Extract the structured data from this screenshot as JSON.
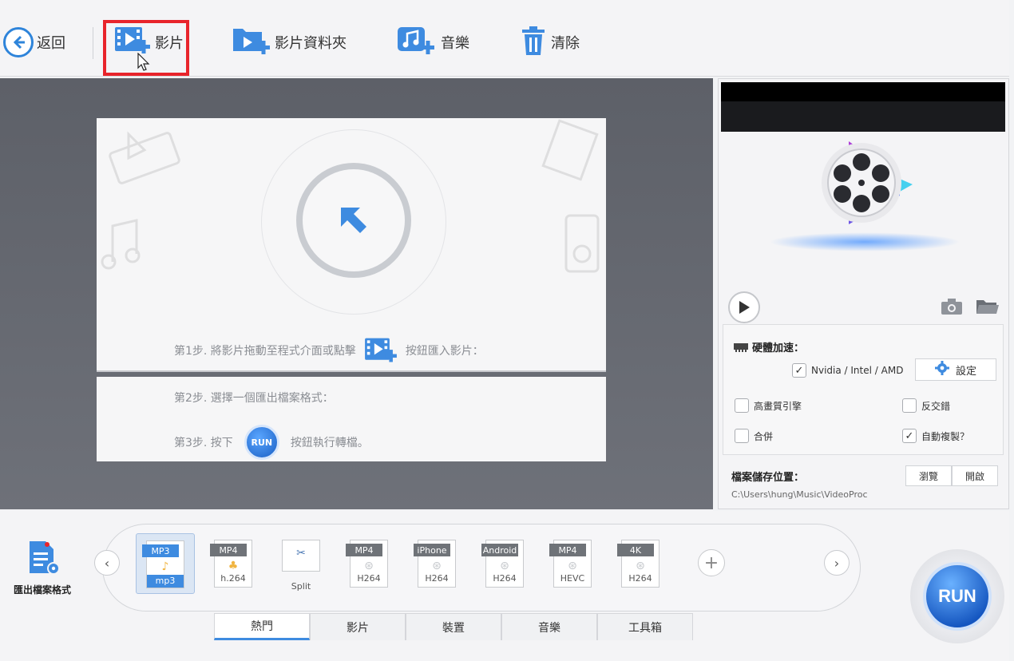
{
  "toolbar": {
    "back_label": "返回",
    "video_label": "影片",
    "video_folder_label": "影片資料夾",
    "music_label": "音樂",
    "clear_label": "清除"
  },
  "drop_area": {
    "step1_prefix": "第1步. 將影片拖動至程式介面或點擊",
    "step1_suffix": "按鈕匯入影片：",
    "step2": "第2步. 選擇一個匯出檔案格式：",
    "step3_prefix": "第3步. 按下",
    "step3_suffix": "按鈕執行轉檔。",
    "run_mini_label": "RUN"
  },
  "right_panel": {
    "hw_accel_title": "硬體加速：",
    "nvidia_label": "Nvidia / Intel / AMD",
    "nvidia_checked": true,
    "settings_label": "設定",
    "options": [
      {
        "label": "高畫質引擎",
        "checked": false
      },
      {
        "label": "反交錯",
        "checked": false
      },
      {
        "label": "合併",
        "checked": false
      },
      {
        "label": "自動複製？",
        "checked": true
      }
    ],
    "save_location_label": "檔案儲存位置：",
    "browse_label": "瀏覽",
    "open_label": "開啟",
    "save_path": "C:\\Users\\hung\\Music\\VideoProc"
  },
  "bottom": {
    "output_format_label": "匯出檔案格式",
    "formats": [
      {
        "tag": "MP3",
        "sub": "mp3",
        "caption": ""
      },
      {
        "tag": "MP4",
        "sub": "h.264",
        "caption": ""
      },
      {
        "tag": "",
        "sub": "",
        "caption": "Split"
      },
      {
        "tag": "MP4",
        "sub": "H264",
        "caption": ""
      },
      {
        "tag": "iPhone",
        "sub": "H264",
        "caption": ""
      },
      {
        "tag": "Android",
        "sub": "H264",
        "caption": ""
      },
      {
        "tag": "MP4",
        "sub": "HEVC",
        "caption": ""
      },
      {
        "tag": "4K",
        "sub": "H264",
        "caption": ""
      }
    ],
    "tabs": [
      "熱門",
      "影片",
      "裝置",
      "音樂",
      "工具箱"
    ],
    "active_tab": "熱門",
    "run_label": "RUN"
  },
  "colors": {
    "accent": "#3e8be0",
    "highlight": "#e8242b"
  }
}
